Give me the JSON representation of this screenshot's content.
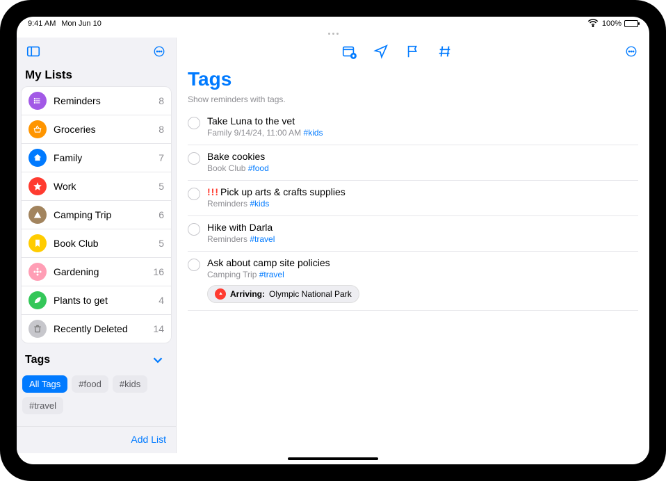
{
  "status": {
    "time": "9:41 AM",
    "date": "Mon Jun 10",
    "battery": "100%"
  },
  "sidebar": {
    "section_title": "My Lists",
    "lists": [
      {
        "name": "Reminders",
        "count": 8,
        "color": "#a259e6",
        "icon": "list"
      },
      {
        "name": "Groceries",
        "count": 8,
        "color": "#ff9500",
        "icon": "basket"
      },
      {
        "name": "Family",
        "count": 7,
        "color": "#007aff",
        "icon": "home"
      },
      {
        "name": "Work",
        "count": 5,
        "color": "#ff3b30",
        "icon": "star"
      },
      {
        "name": "Camping Trip",
        "count": 6,
        "color": "#a2845e",
        "icon": "tent"
      },
      {
        "name": "Book Club",
        "count": 5,
        "color": "#ffcc00",
        "icon": "bookmark"
      },
      {
        "name": "Gardening",
        "count": 16,
        "color": "#ff9eb5",
        "icon": "flower"
      },
      {
        "name": "Plants to get",
        "count": 4,
        "color": "#34c759",
        "icon": "leaf"
      },
      {
        "name": "Recently Deleted",
        "count": 14,
        "color": "#c7c7cc",
        "icon": "trash"
      }
    ],
    "tags_title": "Tags",
    "tags": [
      {
        "label": "All Tags",
        "active": true
      },
      {
        "label": "#food",
        "active": false
      },
      {
        "label": "#kids",
        "active": false
      },
      {
        "label": "#travel",
        "active": false
      }
    ],
    "add_list": "Add List"
  },
  "main": {
    "title": "Tags",
    "subtitle": "Show reminders with tags.",
    "reminders": [
      {
        "title": "Take Luna to the vet",
        "meta": "Family  9/14/24, 11:00 AM",
        "tag": "#kids",
        "priority": ""
      },
      {
        "title": "Bake cookies",
        "meta": "Book Club",
        "tag": "#food",
        "priority": ""
      },
      {
        "title": "Pick up arts & crafts supplies",
        "meta": "Reminders",
        "tag": "#kids",
        "priority": "!!!"
      },
      {
        "title": "Hike with Darla",
        "meta": "Reminders",
        "tag": "#travel",
        "priority": ""
      },
      {
        "title": "Ask about camp site policies",
        "meta": "Camping Trip",
        "tag": "#travel",
        "priority": "",
        "location_label": "Arriving:",
        "location": "Olympic National Park"
      }
    ]
  }
}
